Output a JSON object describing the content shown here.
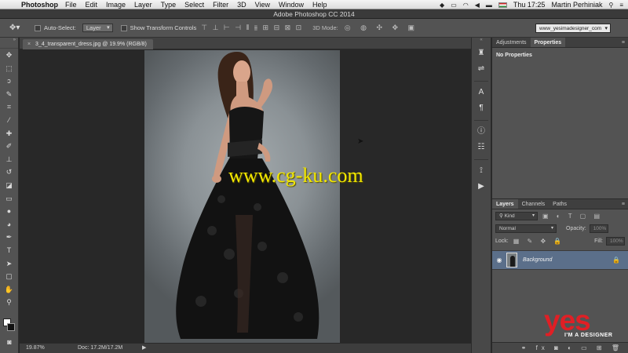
{
  "menubar": {
    "app_name": "Photoshop",
    "items": [
      "File",
      "Edit",
      "Image",
      "Layer",
      "Type",
      "Select",
      "Filter",
      "3D",
      "View",
      "Window",
      "Help"
    ],
    "clock": "Thu 17:25",
    "user": "Martin Perhiniak"
  },
  "window": {
    "title": "Adobe Photoshop CC 2014"
  },
  "options": {
    "auto_select_label": "Auto-Select:",
    "auto_select_value": "Layer",
    "show_transform_label": "Show Transform Controls",
    "mode_3d_label": "3D Mode:",
    "workspace": "www_yesimadesigner_com"
  },
  "document": {
    "tab_label": "3_4_transparent_dress.jpg @ 19.9% (RGB/8)",
    "watermark": "www.cg-ku.com"
  },
  "status": {
    "zoom": "19.87%",
    "doc_info": "Doc: 17.2M/17.2M"
  },
  "properties_panel": {
    "tabs": [
      "Adjustments",
      "Properties"
    ],
    "active_tab": "Properties",
    "body_text": "No Properties"
  },
  "layers_panel": {
    "tabs": [
      "Layers",
      "Channels",
      "Paths"
    ],
    "active_tab": "Layers",
    "filter_label": "Kind",
    "blend_mode": "Normal",
    "opacity_label": "Opacity:",
    "opacity_value": "100%",
    "lock_label": "Lock:",
    "fill_label": "Fill:",
    "fill_value": "100%",
    "layers": [
      {
        "name": "Background",
        "visible": true,
        "locked": true
      }
    ]
  },
  "logo": {
    "word": "yes",
    "tagline": "I'M A DESIGNER"
  },
  "colors": {
    "logo_red": "#e01f25",
    "watermark_yellow": "#f3e800",
    "selected_layer": "#5b6f8a"
  },
  "tools": [
    "move-icon",
    "marquee-icon",
    "lasso-icon",
    "quick-select-icon",
    "crop-icon",
    "eyedropper-icon",
    "healing-icon",
    "brush-icon",
    "stamp-icon",
    "history-brush-icon",
    "eraser-icon",
    "gradient-icon",
    "blur-icon",
    "dodge-icon",
    "pen-icon",
    "type-icon",
    "path-select-icon",
    "shape-icon",
    "hand-icon",
    "zoom-icon"
  ]
}
